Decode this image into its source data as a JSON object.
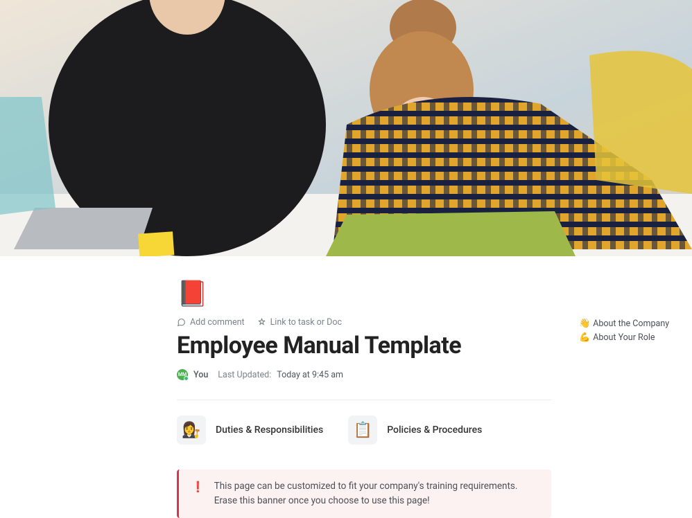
{
  "page_icon": "📕",
  "actions": {
    "add_comment": "Add comment",
    "link_to": "Link to task or Doc"
  },
  "title": "Employee Manual Template",
  "meta": {
    "avatar_initials": "MM",
    "author": "You",
    "last_updated_label": "Last Updated:",
    "last_updated_time": "Today at 9:45 am"
  },
  "section_cards": [
    {
      "icon": "👩‍⚖️",
      "label": "Duties & Responsibilities"
    },
    {
      "icon": "📋",
      "label": "Policies & Procedures"
    }
  ],
  "banner": {
    "icon": "❗",
    "text": "This page can be customized to fit your company's training requirements. Erase this banner once you choose to use this page!"
  },
  "sidebar_links": [
    {
      "icon": "👋",
      "label": "About the Company"
    },
    {
      "icon": "💪",
      "label": "About Your Role"
    }
  ]
}
